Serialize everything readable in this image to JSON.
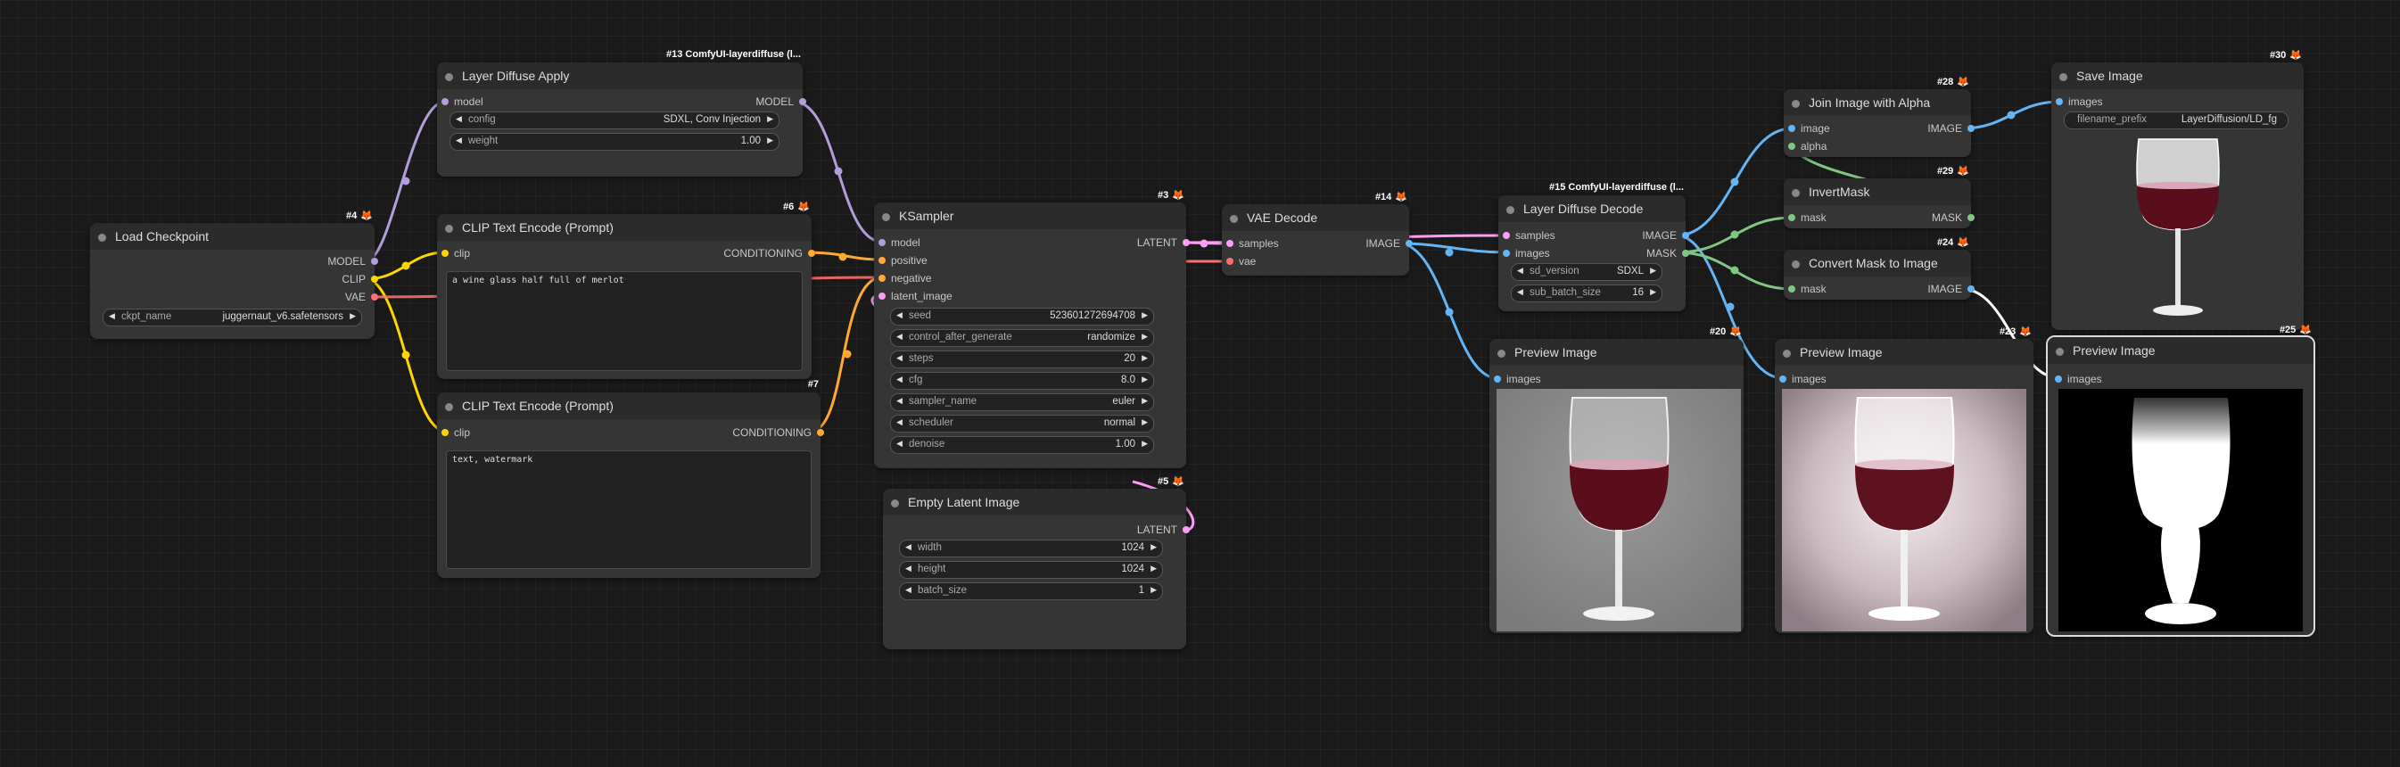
{
  "colors": {
    "model": "#b39ddb",
    "clip": "#ffd500",
    "vae": "#ff6e6e",
    "conditioning": "#ffa931",
    "latent": "#ff9cf9",
    "image": "#64b5f6",
    "mask": "#81c784",
    "canvas": "#1a1a1a",
    "node": "#353535"
  },
  "nodes": {
    "load_checkpoint": {
      "badge": "#4",
      "title": "Load Checkpoint",
      "outputs": [
        "MODEL",
        "CLIP",
        "VAE"
      ],
      "ckpt_label": "ckpt_name",
      "ckpt_value": "juggernaut_v6.safetensors"
    },
    "layer_diffuse_apply": {
      "badge": "#13 ComfyUI-layerdiffuse (l...",
      "title": "Layer Diffuse Apply",
      "input": "model",
      "output": "MODEL",
      "config_label": "config",
      "config_value": "SDXL, Conv Injection",
      "weight_label": "weight",
      "weight_value": "1.00"
    },
    "clip_pos": {
      "badge": "#6",
      "title": "CLIP Text Encode (Prompt)",
      "input": "clip",
      "output": "CONDITIONING",
      "text": "a wine glass half full of merlot"
    },
    "clip_neg": {
      "badge": "#7",
      "title": "CLIP Text Encode (Prompt)",
      "input": "clip",
      "output": "CONDITIONING",
      "text": "text, watermark"
    },
    "ksampler": {
      "badge": "#3",
      "title": "KSampler",
      "inputs": [
        "model",
        "positive",
        "negative",
        "latent_image"
      ],
      "output": "LATENT",
      "widgets": [
        {
          "label": "seed",
          "value": "523601272694708"
        },
        {
          "label": "control_after_generate",
          "value": "randomize"
        },
        {
          "label": "steps",
          "value": "20"
        },
        {
          "label": "cfg",
          "value": "8.0"
        },
        {
          "label": "sampler_name",
          "value": "euler"
        },
        {
          "label": "scheduler",
          "value": "normal"
        },
        {
          "label": "denoise",
          "value": "1.00"
        }
      ]
    },
    "empty_latent": {
      "badge": "#5",
      "title": "Empty Latent Image",
      "output": "LATENT",
      "widgets": [
        {
          "label": "width",
          "value": "1024"
        },
        {
          "label": "height",
          "value": "1024"
        },
        {
          "label": "batch_size",
          "value": "1"
        }
      ]
    },
    "vae_decode": {
      "badge": "#14",
      "title": "VAE Decode",
      "inputs": [
        "samples",
        "vae"
      ],
      "output": "IMAGE"
    },
    "ld_decode": {
      "badge": "#15 ComfyUI-layerdiffuse (l...",
      "title": "Layer Diffuse Decode",
      "inputs": [
        "samples",
        "images"
      ],
      "outputs": [
        "IMAGE",
        "MASK"
      ],
      "widgets": [
        {
          "label": "sd_version",
          "value": "SDXL"
        },
        {
          "label": "sub_batch_size",
          "value": "16"
        }
      ]
    },
    "preview_20": {
      "badge": "#20",
      "title": "Preview Image",
      "input": "images"
    },
    "join_alpha": {
      "badge": "#28",
      "title": "Join Image with Alpha",
      "inputs": [
        "image",
        "alpha"
      ],
      "output": "IMAGE"
    },
    "invert_mask": {
      "badge": "#29",
      "title": "InvertMask",
      "input": "mask",
      "output": "MASK"
    },
    "mask_to_image": {
      "badge": "#24",
      "title": "Convert Mask to Image",
      "input": "mask",
      "output": "IMAGE"
    },
    "preview_23": {
      "badge": "#23",
      "title": "Preview Image",
      "input": "images"
    },
    "save_image": {
      "badge": "#30",
      "title": "Save Image",
      "input": "images",
      "prefix_label": "filename_prefix",
      "prefix_value": "LayerDiffusion/LD_fg"
    },
    "preview_25": {
      "badge": "#25",
      "title": "Preview Image",
      "input": "images"
    }
  }
}
